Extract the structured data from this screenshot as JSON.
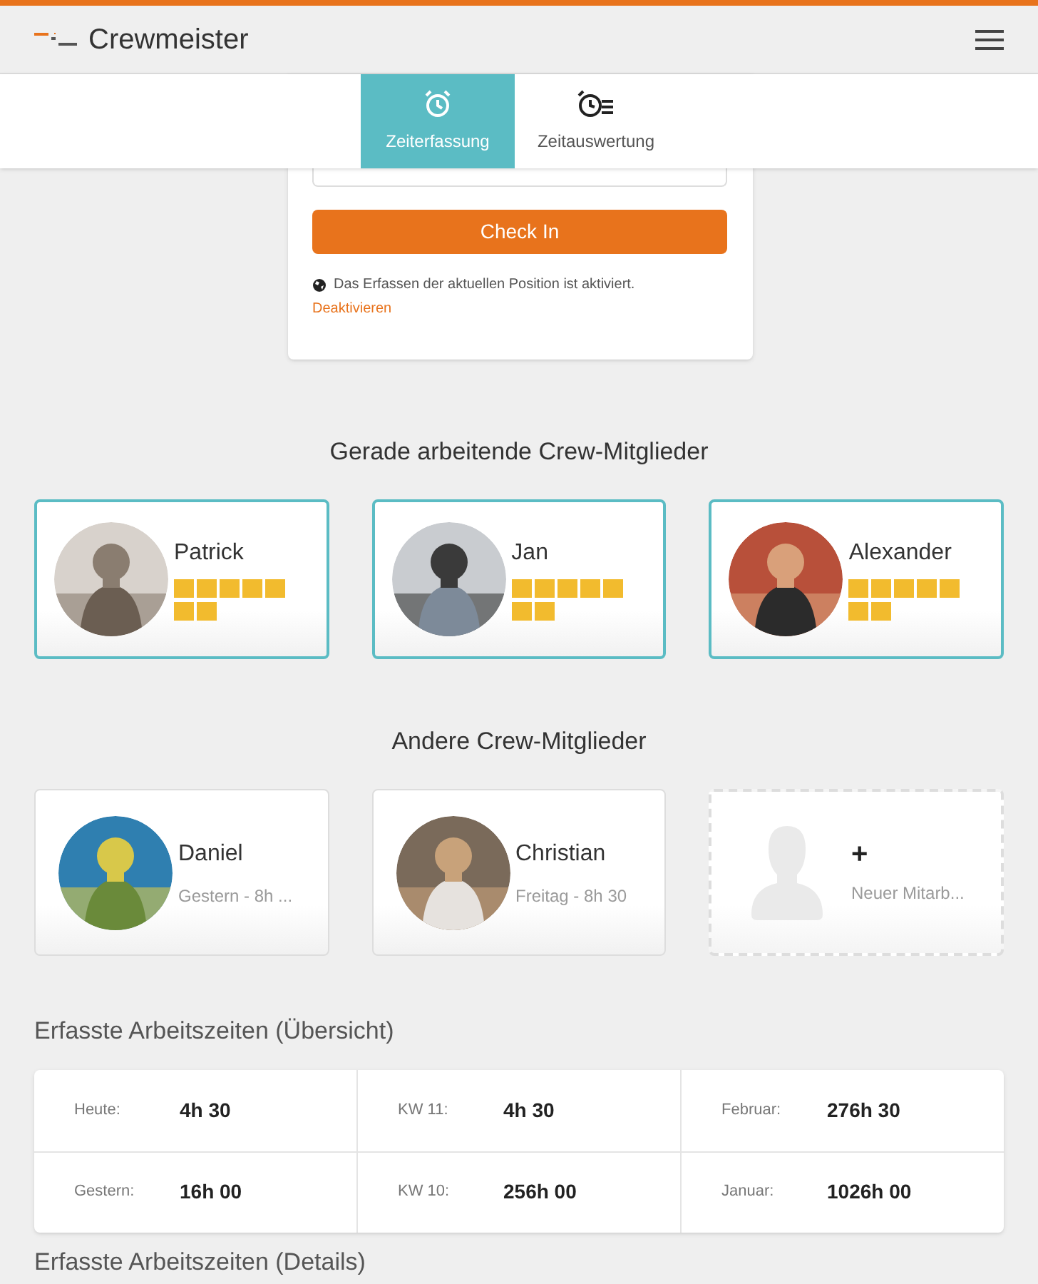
{
  "header": {
    "app_name": "Crewmeister"
  },
  "tabs": [
    {
      "label": "Zeiterfassung",
      "selected": true,
      "kind": "alarm"
    },
    {
      "label": "Zeitauswertung",
      "selected": false,
      "kind": "report"
    }
  ],
  "checkin": {
    "button": "Check In",
    "location_note": "Das Erfassen der aktuellen Position ist aktiviert.",
    "link": "Deaktivieren"
  },
  "working": {
    "title": "Gerade arbeitende Crew-Mitglieder",
    "members": [
      {
        "name": "Patrick"
      },
      {
        "name": "Jan"
      },
      {
        "name": "Alexander"
      }
    ]
  },
  "others": {
    "title": "Andere Crew-Mitglieder",
    "members": [
      {
        "kind": "member",
        "name": "Daniel",
        "subtitle": "Gestern - 8h ..."
      },
      {
        "kind": "member",
        "name": "Christian",
        "subtitle": "Freitag - 8h 30"
      },
      {
        "kind": "add",
        "name": "+",
        "subtitle": "Neuer Mitarb..."
      }
    ]
  },
  "overview": {
    "title": "Erfasste Arbeitszeiten (Übersicht)",
    "rows": [
      [
        {
          "label": "Heute:",
          "value": "4h 30"
        },
        {
          "label": "KW 11:",
          "value": "4h 30"
        },
        {
          "label": "Februar:",
          "value": "276h 30"
        }
      ],
      [
        {
          "label": "Gestern:",
          "value": "16h 00"
        },
        {
          "label": "KW 10:",
          "value": "256h 00"
        },
        {
          "label": "Januar:",
          "value": "1026h 00"
        }
      ]
    ]
  },
  "details": {
    "title": "Erfasste Arbeitszeiten (Details)"
  }
}
